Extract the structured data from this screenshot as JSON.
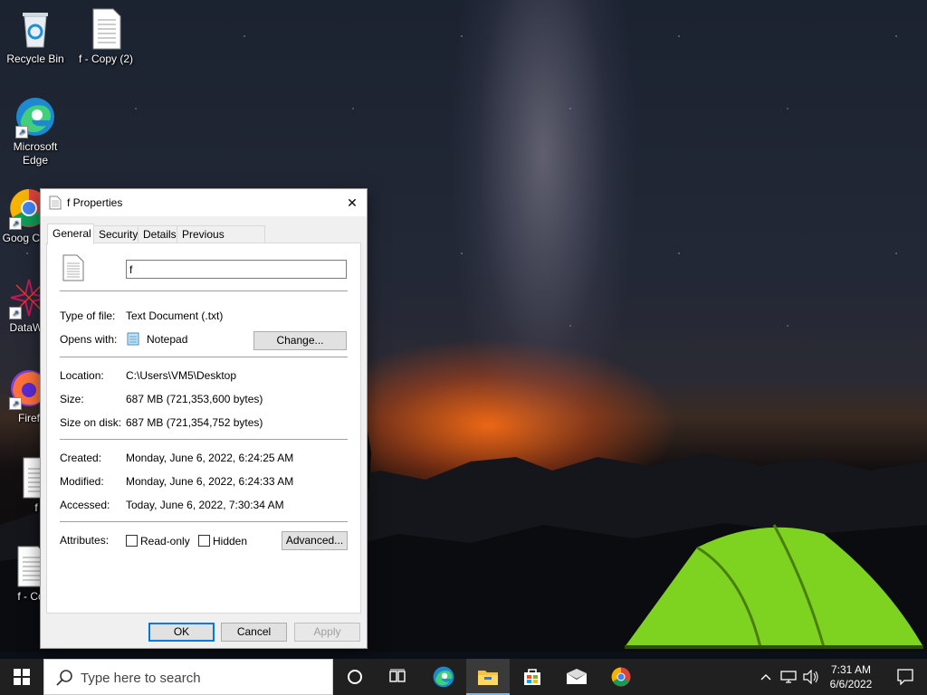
{
  "desktop": {
    "icons": [
      {
        "label": "Recycle Bin"
      },
      {
        "label": "f - Copy (2)"
      },
      {
        "label": "Microsoft Edge"
      },
      {
        "label": "Goog Chro"
      },
      {
        "label": "DataWa"
      },
      {
        "label": "Firef"
      },
      {
        "label": "f"
      },
      {
        "label": "f - Co"
      }
    ]
  },
  "dialog": {
    "title": "f Properties",
    "close_glyph": "✕",
    "tabs": [
      "General",
      "Security",
      "Details",
      "Previous Versions"
    ],
    "active_tab": "General",
    "file_name": "f",
    "type_label": "Type of file:",
    "type_value": "Text Document (.txt)",
    "opens_label": "Opens with:",
    "opens_value": "Notepad",
    "change_button": "Change...",
    "location_label": "Location:",
    "location_value": "C:\\Users\\VM5\\Desktop",
    "size_label": "Size:",
    "size_value": "687 MB (721,353,600 bytes)",
    "size_disk_label": "Size on disk:",
    "size_disk_value": "687 MB (721,354,752 bytes)",
    "created_label": "Created:",
    "created_value": "Monday, June 6, 2022, 6:24:25 AM",
    "modified_label": "Modified:",
    "modified_value": "Monday, June 6, 2022, 6:24:33 AM",
    "accessed_label": "Accessed:",
    "accessed_value": "Today, June 6, 2022, 7:30:34 AM",
    "attributes_label": "Attributes:",
    "readonly_label": "Read-only",
    "hidden_label": "Hidden",
    "readonly_checked": false,
    "hidden_checked": false,
    "advanced_button": "Advanced...",
    "ok_button": "OK",
    "cancel_button": "Cancel",
    "apply_button": "Apply"
  },
  "taskbar": {
    "search_placeholder": "Type here to search",
    "pinned": [
      "cortana-icon",
      "task-view-icon",
      "edge-icon",
      "file-explorer-icon",
      "store-icon",
      "mail-icon",
      "chrome-icon"
    ],
    "active_app": "file-explorer-icon",
    "time": "7:31 AM",
    "date": "6/6/2022"
  },
  "colors": {
    "accent": "#0078d7",
    "taskbar_bg": "#202020",
    "tent_green": "#7ed321"
  }
}
